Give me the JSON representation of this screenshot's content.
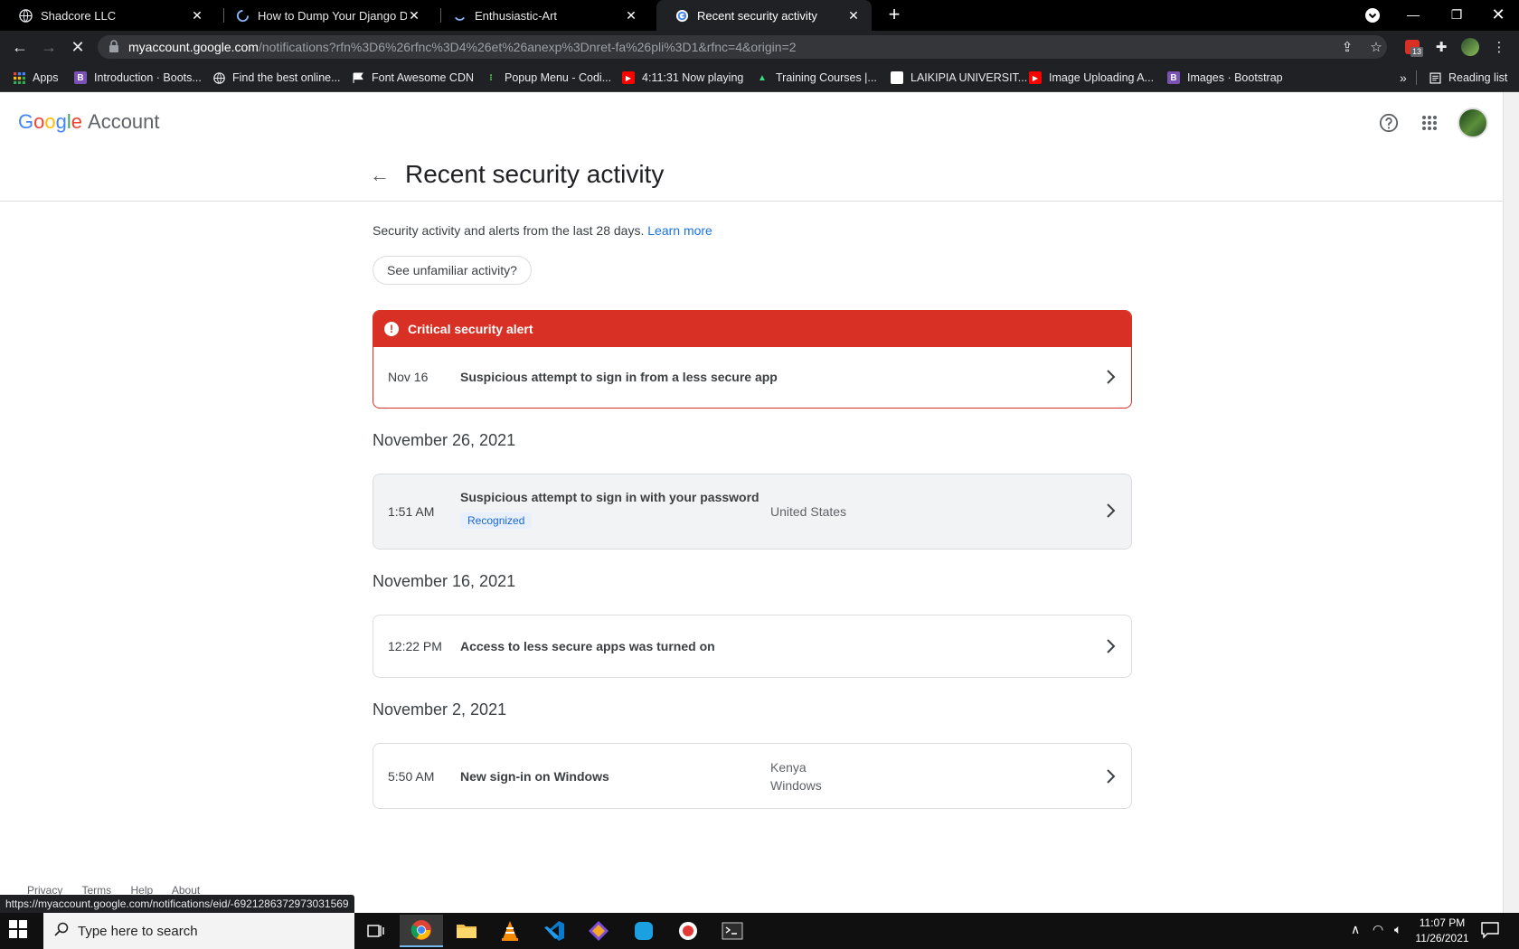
{
  "browser": {
    "tabs": [
      {
        "title": "Shadcore LLC",
        "icon": "globe-icon"
      },
      {
        "title": "How to Dump Your Django Data",
        "icon": "loading-spinner-icon"
      },
      {
        "title": "Enthusiastic-Art",
        "icon": "loading-spinner-icon"
      },
      {
        "title": "Recent security activity",
        "icon": "google-icon"
      }
    ],
    "url_host": "myaccount.google.com",
    "url_path": "/notifications?rfn%3D6%26rfnc%3D4%26et%26anexp%3Dnret-fa%26pli%3D1&rfnc=4&origin=2",
    "extension_badge": "13",
    "bookmarks": [
      {
        "label": "Apps"
      },
      {
        "label": "Introduction · Boots..."
      },
      {
        "label": "Find the best online..."
      },
      {
        "label": "Font Awesome CDN"
      },
      {
        "label": "Popup Menu - Codi..."
      },
      {
        "label": "4:11:31 Now playing"
      },
      {
        "label": "Training Courses |..."
      },
      {
        "label": "LAIKIPIA UNIVERSIT..."
      },
      {
        "label": "Image Uploading A..."
      },
      {
        "label": "Images · Bootstrap"
      }
    ],
    "more_bookmarks": "»",
    "reading_list": "Reading list",
    "status_url": "https://myaccount.google.com/notifications/eid/-6921286372973031569"
  },
  "header": {
    "logo_google": [
      "G",
      "o",
      "o",
      "g",
      "l",
      "e"
    ],
    "logo_account": "Account"
  },
  "page": {
    "title": "Recent security activity",
    "intro": "Security activity and alerts from the last 28 days.",
    "learn_more": "Learn more",
    "unfamiliar_button": "See unfamiliar activity?",
    "alert": {
      "heading": "Critical security alert",
      "date": "Nov 16",
      "event": "Suspicious attempt to sign in from a less secure app"
    },
    "sections": [
      {
        "date": "November 26, 2021",
        "time": "1:51 AM",
        "event": "Suspicious attempt to sign in with your password",
        "badge": "Recognized",
        "location": "United States"
      },
      {
        "date": "November 16, 2021",
        "time": "12:22 PM",
        "event": "Access to less secure apps was turned on"
      },
      {
        "date": "November 2, 2021",
        "time": "5:50 AM",
        "event": "New sign-in on Windows",
        "location": "Kenya",
        "device": "Windows"
      }
    ],
    "footer": [
      "Privacy",
      "Terms",
      "Help",
      "About"
    ]
  },
  "taskbar": {
    "search_placeholder": "Type here to search",
    "time": "11:07 PM",
    "date": "11/26/2021"
  },
  "colors": {
    "alert_red": "#d93025",
    "link_blue": "#1a73e8",
    "badge_bg": "#e8f0fe"
  }
}
